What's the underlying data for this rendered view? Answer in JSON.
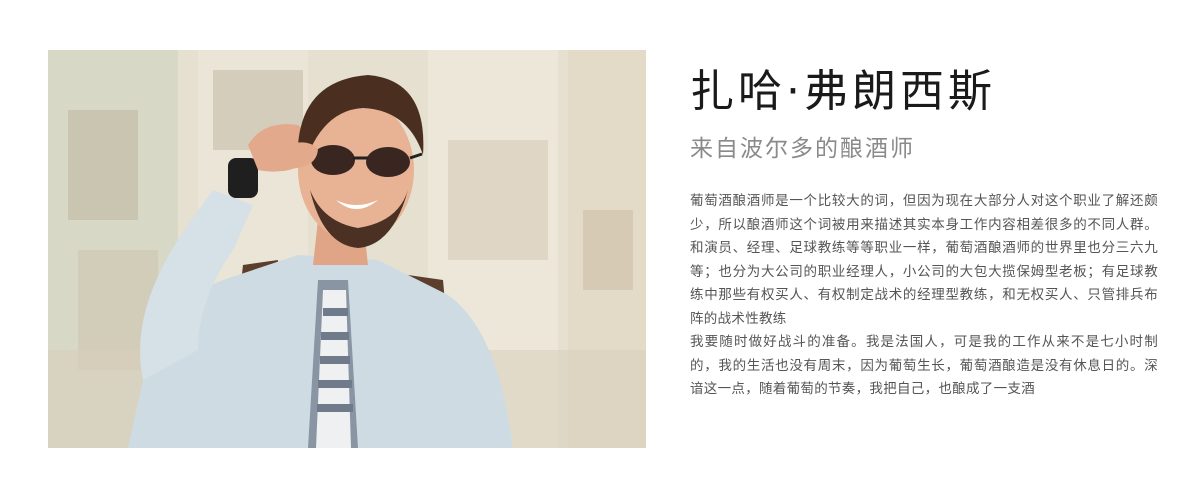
{
  "profile": {
    "name": "扎哈·弗朗西斯",
    "subtitle": "来自波尔多的酿酒师",
    "bio": [
      "葡萄酒酿酒师是一个比较大的词，但因为现在大部分人对这个职业了解还颇少，所以酿酒师这个词被用来描述其实本身工作内容相差很多的不同人群。和演员、经理、足球教练等等职业一样，葡萄酒酿酒师的世界里也分三六九等；也分为大公司的职业经理人，小公司的大包大揽保姆型老板；有足球教练中那些有权买人、有权制定战术的经理型教练，和无权买人、只管排兵布阵的战术性教练",
      "我要随时做好战斗的准备。我是法国人，可是我的工作从来不是七小时制的，我的生活也没有周末，因为葡萄生长，葡萄酒酿造是没有休息日的。深谙这一点，随着葡萄的节奏，我把自己，也酿成了一支酒"
    ]
  }
}
